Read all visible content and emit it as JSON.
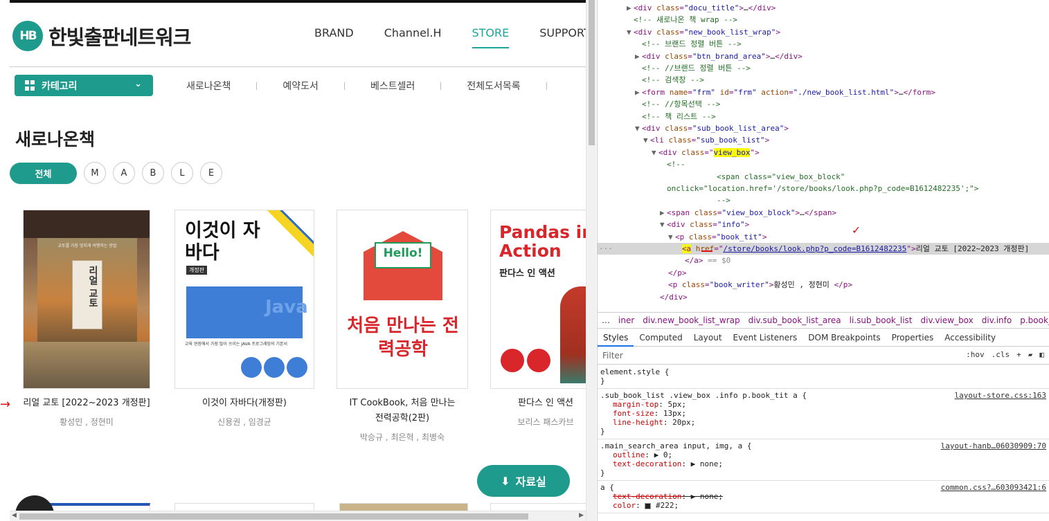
{
  "store": {
    "logo_mark": "HB",
    "logo_text": "한빛출판네트워크",
    "gnb": [
      {
        "label": "BRAND",
        "active": false
      },
      {
        "label": "Channel.H",
        "active": false
      },
      {
        "label": "STORE",
        "active": true
      },
      {
        "label": "SUPPORT",
        "active": false
      }
    ],
    "category_label": "카테고리",
    "subnav": [
      "새로나온책",
      "예약도서",
      "베스트셀러",
      "전체도서목록"
    ],
    "page_title": "새로나온책",
    "filters": {
      "all": "전체",
      "brands": [
        "M",
        "A",
        "B",
        "L",
        "E"
      ]
    },
    "books": [
      {
        "title": "리얼 교토 [2022~2023 개정판]",
        "writer": "황성민 , 정현미",
        "cover_title": "리얼 교토",
        "cover_sub": "교토를 가장 멋지게 여행하는 방법"
      },
      {
        "title": "이것이 자바다(개정판)",
        "writer": "신용권 , 임경균",
        "cover_title": "이것이 자바다",
        "cover_sub": "교육 현장에서 가장 많이 쓰이는 JAVA 프로그래밍의 기본서",
        "cover_tag": "개정판"
      },
      {
        "title_lines": [
          "IT CookBook, 처음 만나는",
          "전력공학(2판)"
        ],
        "writer": "박승규 , 최은혁 , 최병숙",
        "cover_title": "처음 만나는 전력공학",
        "cover_hello": "Hello!"
      },
      {
        "title": "판다스 인 액션",
        "writer": "보리스 패스카브",
        "cover_title": "Pandas in Action",
        "cover_sub": "판다스 인 액션"
      }
    ],
    "download_label": "자료실",
    "colors": {
      "accent": "#1f9b8e",
      "active_nav": "#1aa79a"
    }
  },
  "devtools": {
    "dom_lines": [
      {
        "indent": 0,
        "tri": "▶",
        "html": "<div class=\"docu_title\">…</div>"
      },
      {
        "indent": 0,
        "tri": "",
        "comment": "<!-- 새로나온 책 wrap -->"
      },
      {
        "indent": 0,
        "tri": "▼",
        "html": "<div class=\"new_book_list_wrap\">"
      },
      {
        "indent": 1,
        "tri": "",
        "comment": "<!-- 브랜드 정렬 버튼 -->"
      },
      {
        "indent": 1,
        "tri": "▶",
        "html": "<div class=\"btn_brand_area\">…</div>"
      },
      {
        "indent": 1,
        "tri": "",
        "comment": "<!-- //브랜드 정렬 버튼 -->"
      },
      {
        "indent": 1,
        "tri": "",
        "comment": "<!-- 검색창 -->"
      },
      {
        "indent": 1,
        "tri": "▶",
        "html": "<form name=\"frm\" id=\"frm\" action=\"./new_book_list.html\">…</form>"
      },
      {
        "indent": 1,
        "tri": "",
        "comment": "<!-- //항목선택 -->"
      },
      {
        "indent": 1,
        "tri": "",
        "comment": "<!-- 책 리스트 -->"
      },
      {
        "indent": 1,
        "tri": "▼",
        "html": "<div class=\"sub_book_list_area\">"
      },
      {
        "indent": 2,
        "tri": "▼",
        "html": "<li class=\"sub_book_list\">"
      }
    ],
    "view_box_line": {
      "prefix": "<div class=\"",
      "hl": "view_box",
      "suffix": "\">"
    },
    "comment_block": [
      "<!--",
      "<span class=\"view_box_block\"",
      "onclick=\"location.href='/store/books/look.php?p_code=B1612482235';\">",
      "-->"
    ],
    "after_lines": [
      {
        "indent": 4,
        "tri": "▶",
        "html": "<span class=\"view_box_block\">…</span>"
      },
      {
        "indent": 4,
        "tri": "▼",
        "html": "<div class=\"info\">"
      },
      {
        "indent": 5,
        "tri": "▼",
        "html": "<p class=\"book_tit\">"
      }
    ],
    "selected_line": {
      "tag_open": "<a",
      "attr": "href",
      "eq": "=\"",
      "url": "/store/books/look.php?p_code=B1612482235",
      "close": "\">",
      "text": "리얼 교토 [2022~2023 개정판]"
    },
    "closing_lines": [
      {
        "indent": 7,
        "html": "</a> == $0"
      },
      {
        "indent": 5,
        "html": "</p>"
      },
      {
        "indent": 5,
        "html": "<p class=\"book_writer\">황성민 , 정현미 </p>"
      },
      {
        "indent": 4,
        "html": "</div>"
      }
    ],
    "breadcrumb": [
      "iner",
      "div.new_book_list_wrap",
      "div.sub_book_list_area",
      "li.sub_book_list",
      "div.view_box",
      "div.info",
      "p.book_tit",
      "a"
    ],
    "tabs": [
      "Styles",
      "Computed",
      "Layout",
      "Event Listeners",
      "DOM Breakpoints",
      "Properties",
      "Accessibility"
    ],
    "filter_placeholder": "Filter",
    "filter_tools": [
      ":hov",
      ".cls",
      "+"
    ],
    "rules": [
      {
        "selector": "element.style {",
        "source": "",
        "props": [],
        "close": "}"
      },
      {
        "selector": ".sub_book_list .view_box .info p.book_tit a {",
        "source": "layout-store.css:163",
        "props": [
          [
            "margin-top",
            "5px;"
          ],
          [
            "font-size",
            "13px;"
          ],
          [
            "line-height",
            "20px;"
          ]
        ],
        "close": "}"
      },
      {
        "selector": ".main_search_area input, img, a {",
        "source": "layout-hanb…06030909:70",
        "props": [
          [
            "outline",
            "▶ 0;"
          ],
          [
            "text-decoration",
            "▶ none;"
          ]
        ],
        "close": "}"
      },
      {
        "selector": "a {",
        "source": "common.css?…603093421:6",
        "props": [
          [
            "text-decoration",
            "▶ none;"
          ],
          [
            "color",
            "#222;"
          ]
        ],
        "close": ""
      }
    ]
  }
}
